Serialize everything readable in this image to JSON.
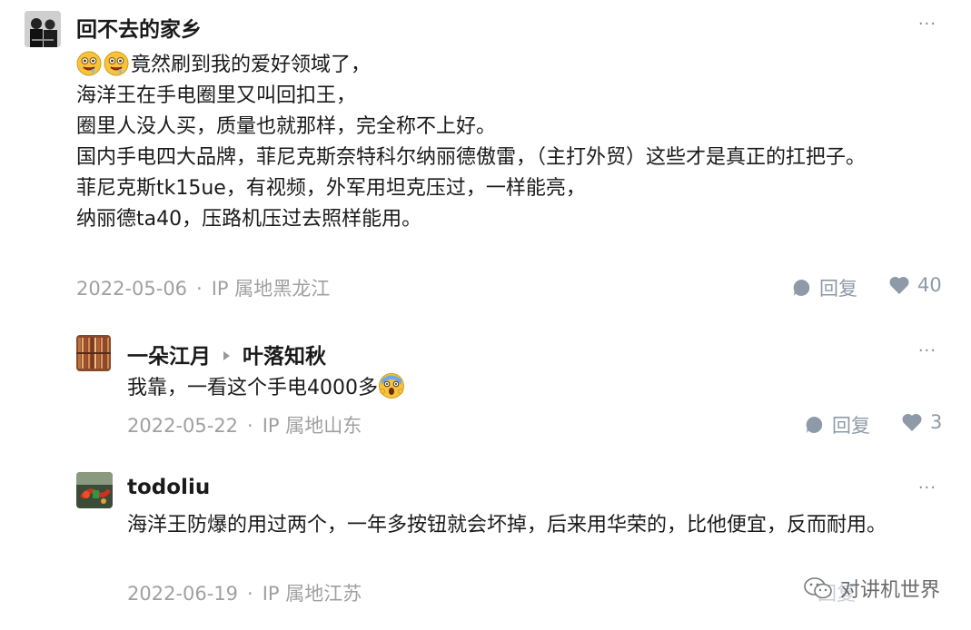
{
  "comments": [
    {
      "author": "回不去的家乡",
      "lines": [
        "竟然刷到我的爱好领域了，",
        "海洋王在手电圈里又叫回扣王，",
        "圈里人没人买，质量也就那样，完全称不上好。",
        "国内手电四大品牌，菲尼克斯奈特科尔纳丽德傲雷，（主打外贸）这些才是真正的扛把子。",
        "菲尼克斯tk15ue，有视频，外军用坦克压过，一样能亮，",
        "纳丽德ta40，压路机压过去照样能用。"
      ],
      "date": "2022-05-06",
      "ip": "IP 属地黑龙江",
      "reply_label": "回复",
      "likes": "40"
    },
    {
      "author": "一朵江月",
      "reply_to": "叶落知秋",
      "text": "我靠，一看这个手电4000多",
      "date": "2022-05-22",
      "ip": "IP 属地山东",
      "reply_label": "回复",
      "likes": "3"
    },
    {
      "author": "todoliu",
      "text": "海洋王防爆的用过两个，一年多按钮就会坏掉，后来用华荣的，比他便宜，反而耐用。",
      "date": "2022-06-19",
      "ip": "IP 属地江苏",
      "reply_label": "回复"
    }
  ],
  "more_label": "···",
  "separator": "·",
  "watermark": "对讲机世界",
  "icons": {
    "reply": "speech-bubble-icon",
    "like": "heart-icon",
    "emoji_first": "drooling-face-emoji",
    "emoji_second": "screaming-face-emoji",
    "watermark": "wechat-icon"
  },
  "colors": {
    "action": "#8e9aa8",
    "meta": "#a0a0a0",
    "text": "#1a1a1a"
  }
}
